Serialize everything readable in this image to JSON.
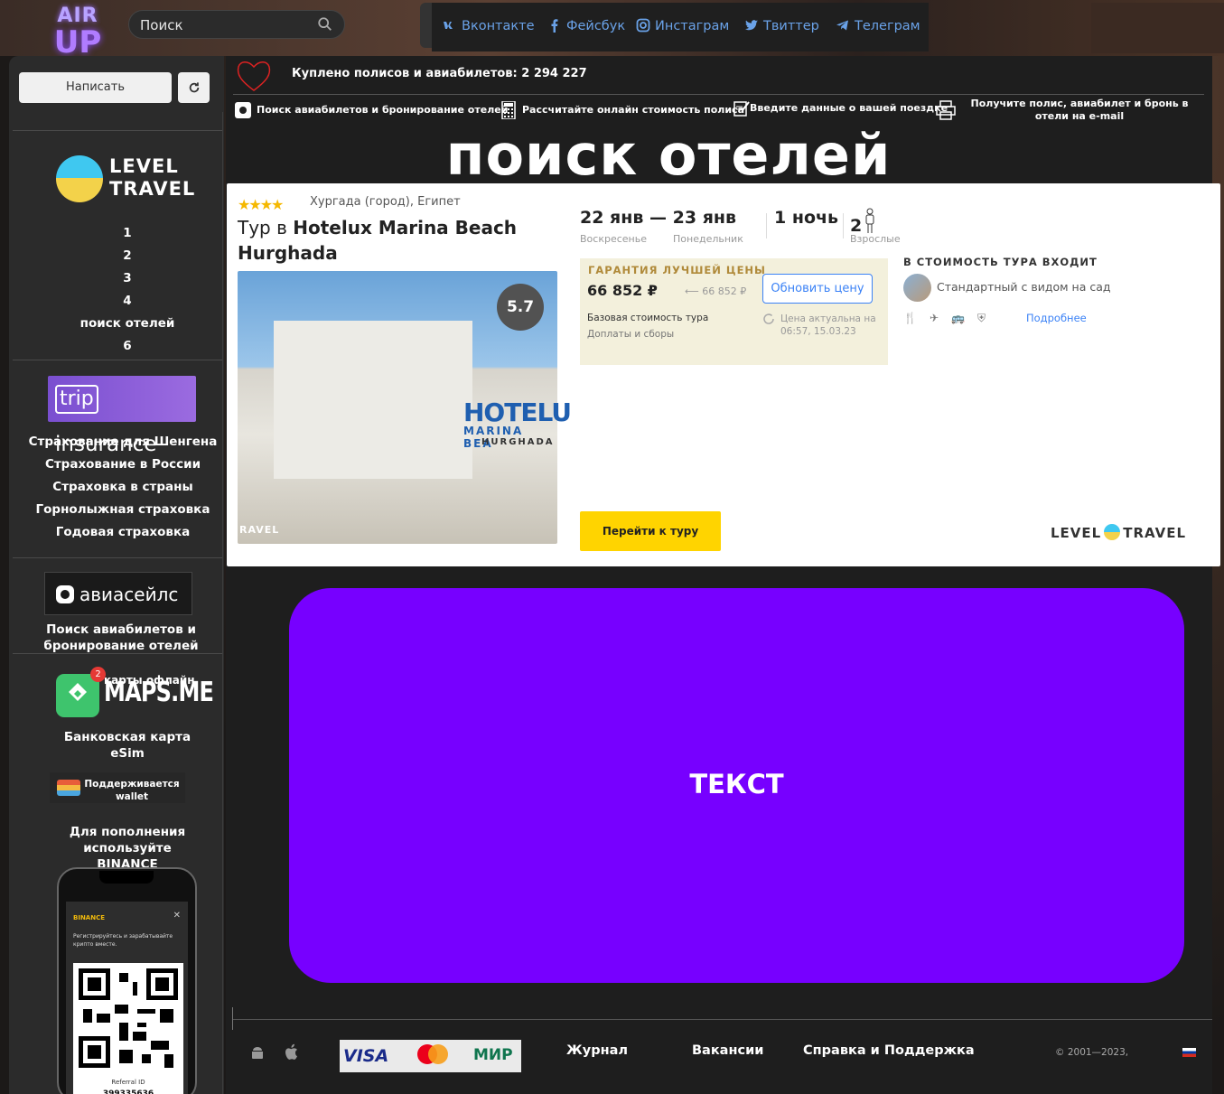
{
  "brand": {
    "line1": "AIR",
    "line2": "UP"
  },
  "search": {
    "placeholder": "Поиск"
  },
  "social": [
    {
      "label": "Вконтакте",
      "icon": "vk-icon"
    },
    {
      "label": "Фейсбук",
      "icon": "facebook-icon"
    },
    {
      "label": "Инстаграм",
      "icon": "instagram-icon"
    },
    {
      "label": "Твиттер",
      "icon": "twitter-icon"
    },
    {
      "label": "Телеграм",
      "icon": "telegram-icon"
    }
  ],
  "sidebar": {
    "write_label": "Написать",
    "level_travel": {
      "word1": "LEVEL",
      "word2": "TRAVEL"
    },
    "nav": [
      "1",
      "2",
      "3",
      "4",
      "поиск отелей",
      "6"
    ],
    "trip_insurance": {
      "part1": "trip",
      "part2": "insurance"
    },
    "insurance_links": [
      "Страхование для Шенгена",
      "Страхование в России",
      "Страховка в страны",
      "Горнолыжная страховка",
      "Годовая страховка"
    ],
    "aviasales_label": "авиасейлс",
    "aviasales_text": "Поиск авиабилетов и бронирование отелей",
    "maps": {
      "badge": "2",
      "offline": "карты офлайн",
      "word": "MAPS.ME"
    },
    "bank_card": "Банковская карта eSim",
    "wallet": "Поддерживается wallet",
    "binance_note": "Для пополнения используйте BINANCE",
    "phone": {
      "brand": "BINANCE",
      "text": "Регистрируйтесь и зарабатывайте крипто вместе.",
      "close": "✕",
      "ref_label": "Referral ID",
      "ref_value": "399335636"
    }
  },
  "header": {
    "bought": "Куплено полисов и авиабилетов: 2 294 227",
    "steps": [
      "Поиск авиабилетов и бронирование отелей",
      "Рассчитайте онлайн стоимость полиса",
      "Введите данные о вашей поездке",
      "Получите полис, авиабилет и бронь в отели на e-mail"
    ]
  },
  "page_title": "поиск отелей",
  "tour": {
    "stars": 4,
    "location": "Хургада (город), Египет",
    "prefix": "Тур в",
    "hotel": "Hotelux Marina Beach Hurghada",
    "photo_sign": {
      "line1": "HOTELU",
      "line2": "MARINA BEA",
      "line3": "HURGHADA",
      "watermark": "RAVEL"
    },
    "rating": "5.7",
    "dates": "22 янв — 23 янв",
    "day_from": "Воскресенье",
    "day_to": "Понедельник",
    "nights": "1 ночь",
    "adults": "2",
    "adults_label": "Взрослые",
    "guarantee": "ГАРАНТИЯ ЛУЧШЕЙ ЦЕНЫ",
    "price": "66 852 ₽",
    "old_price": "66 852 ₽",
    "base_label": "Базовая стоимость тура",
    "extra_label": "Доплаты и сборы",
    "update_btn": "Обновить цену",
    "actual": "Цена актуальна на 06:57, 15.03.23",
    "included_title": "В СТОИМОСТЬ ТУРА ВХОДИТ",
    "room": "Стандартный с видом на сад",
    "more": "Подробнее",
    "go_btn": "Перейти к туру",
    "lt_logo1": "LEVEL",
    "lt_logo2": "TRAVEL"
  },
  "promo": {
    "text": "ТЕКСТ",
    "color": "#7700ff"
  },
  "footer": {
    "links": [
      "Журнал",
      "Вакансии",
      "Справка и Поддержка"
    ],
    "payments": {
      "visa": "VISA",
      "mir": "МИР"
    },
    "copyright": "© 2001—2023, "
  }
}
